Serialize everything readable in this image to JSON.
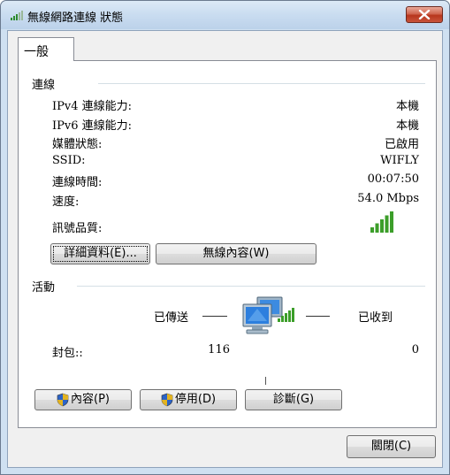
{
  "window": {
    "title": "無線網路連線 狀態",
    "close_icon": "close-icon"
  },
  "tab": {
    "label": "一般"
  },
  "connection": {
    "heading": "連線",
    "rows": [
      {
        "label": "IPv4 連線能力:",
        "value": "本機"
      },
      {
        "label": "IPv6 連線能力:",
        "value": "本機"
      },
      {
        "label": "媒體狀態:",
        "value": "已啟用"
      },
      {
        "label": "SSID:",
        "value": "WIFLY"
      },
      {
        "label": "連線時間:",
        "value": "00:07:50"
      },
      {
        "label": "速度:",
        "value": "54.0 Mbps"
      }
    ],
    "signal_label": "訊號品質:",
    "signal_bars": 5,
    "signal_color": "#3c9e2a",
    "details_button": "詳細資料(E)...",
    "wireless_props_button": "無線內容(W)"
  },
  "activity": {
    "heading": "活動",
    "sent_label": "已傳送",
    "received_label": "已收到",
    "packets_label": "封包::",
    "packets_sent": "116",
    "packets_received": "0"
  },
  "buttons": {
    "properties": "內容(P)",
    "disable": "停用(D)",
    "diagnose": "診斷(G)",
    "close": "關閉(C)"
  }
}
